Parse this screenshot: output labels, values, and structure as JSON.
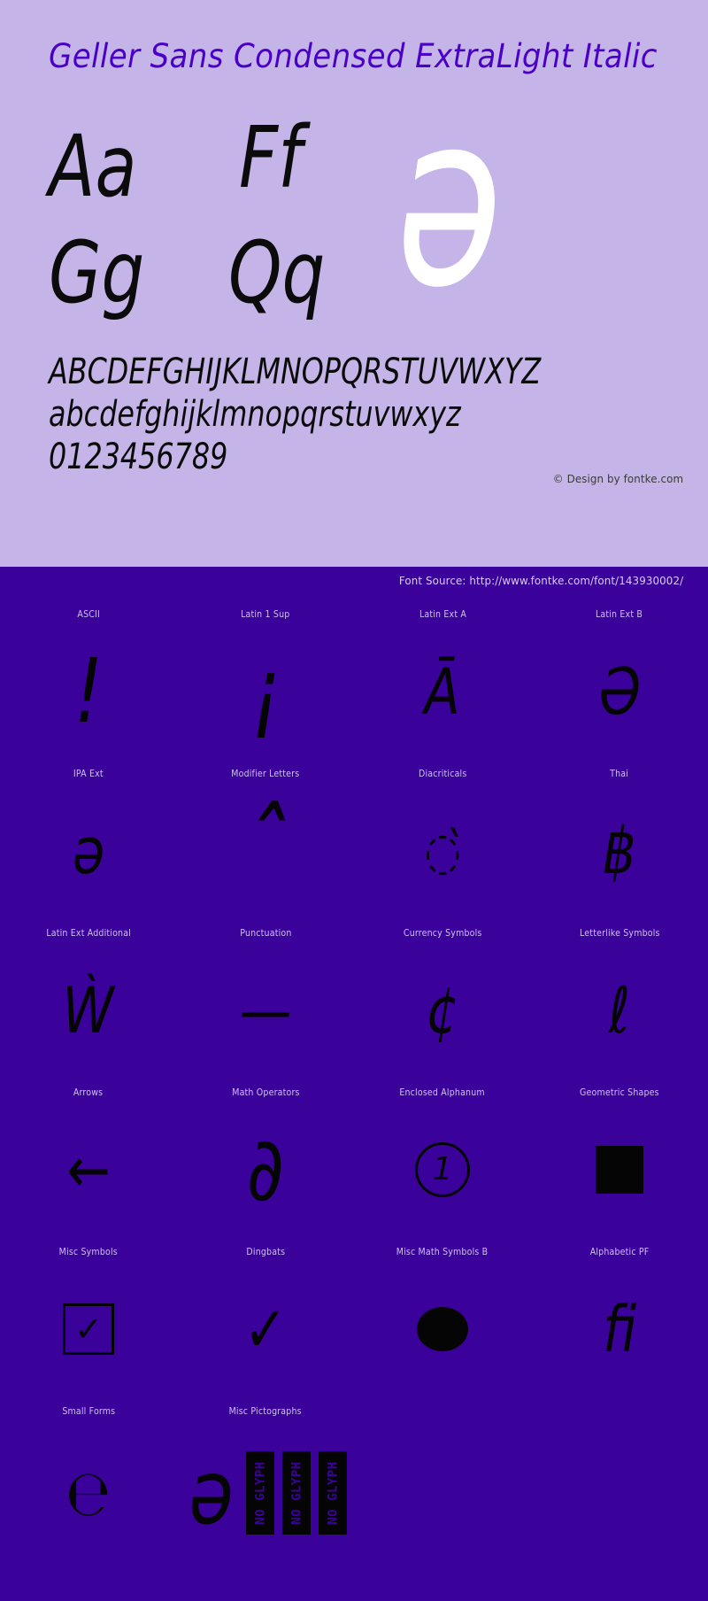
{
  "specimen": {
    "title": "Geller Sans Condensed ExtraLight Italic",
    "background_color": "#c5b4e8",
    "title_color": "#4b00c8",
    "sample_pairs": [
      "Aa",
      "Ff",
      "Gg",
      "Qq"
    ],
    "hero_glyph": "ə",
    "hero_color": "#ffffff",
    "alphabet_upper": "ABCDEFGHIJKLMNOPQRSTUVWXYZ",
    "alphabet_lower": "abcdefghijklmnopqrstuvwxyz",
    "digits": "0123456789",
    "credit": "© Design by fontke.com"
  },
  "source_bar": {
    "text": "Font Source: http://www.fontke.com/font/143930002/",
    "background_color": "#3a029b",
    "text_color": "#d7cdf0"
  },
  "glyph_section": {
    "background_color": "#3a029b",
    "label_color": "#cfc2ee",
    "glyph_color": "#050505",
    "rows": [
      {
        "cells": [
          {
            "label": "ASCII",
            "glyph": "!",
            "kind": "char",
            "size": "lg"
          },
          {
            "label": "Latin 1 Sup",
            "glyph": "¡",
            "kind": "char",
            "size": "lg"
          },
          {
            "label": "Latin Ext A",
            "glyph": "Ā",
            "kind": "char",
            "size": "md"
          },
          {
            "label": "Latin Ext B",
            "glyph": "Ə",
            "kind": "char",
            "size": "md"
          }
        ]
      },
      {
        "cells": [
          {
            "label": "IPA Ext",
            "glyph": "ə",
            "kind": "char",
            "size": "md"
          },
          {
            "label": "Modifier Letters",
            "glyph": "ˆ",
            "kind": "char",
            "size": "xl"
          },
          {
            "label": "Diacriticals",
            "glyph": "◌̀",
            "kind": "char",
            "size": "sm"
          },
          {
            "label": "Thai",
            "glyph": "฿",
            "kind": "char",
            "size": "md"
          }
        ]
      },
      {
        "cells": [
          {
            "label": "Latin Ext Additional",
            "glyph": "Ẁ",
            "kind": "char",
            "size": "md"
          },
          {
            "label": "Punctuation",
            "glyph": "—",
            "kind": "char",
            "size": "md"
          },
          {
            "label": "Currency Symbols",
            "glyph": "¢",
            "kind": "char",
            "size": "md"
          },
          {
            "label": "Letterlike Symbols",
            "glyph": "ℓ",
            "kind": "char",
            "size": "md"
          }
        ]
      },
      {
        "cells": [
          {
            "label": "Arrows",
            "glyph": "←",
            "kind": "char",
            "size": "md"
          },
          {
            "label": "Math Operators",
            "glyph": "∂",
            "kind": "char",
            "size": "lg"
          },
          {
            "label": "Enclosed Alphanum",
            "glyph": "1",
            "kind": "circled",
            "size": "md"
          },
          {
            "label": "Geometric Shapes",
            "glyph": "■",
            "kind": "square",
            "size": "md"
          }
        ]
      },
      {
        "cells": [
          {
            "label": "Misc Symbols",
            "glyph": "✓",
            "kind": "boxed",
            "size": "md"
          },
          {
            "label": "Dingbats",
            "glyph": "✓",
            "kind": "char",
            "size": "md"
          },
          {
            "label": "Misc Math Symbols B",
            "glyph": "●",
            "kind": "ellipse",
            "size": "md"
          },
          {
            "label": "Alphabetic PF",
            "glyph": "ﬁ",
            "kind": "char",
            "size": "md"
          }
        ]
      },
      {
        "cells": [
          {
            "label": "Small Forms",
            "glyph": "℮",
            "kind": "char",
            "size": "md"
          },
          {
            "label": "Misc Pictographs",
            "glyph": "ə",
            "kind": "noglyph",
            "size": "md",
            "noglyph_labels": [
              "NO GLYPH",
              "NO GLYPH",
              "NO GLYPH"
            ]
          },
          {
            "label": "",
            "glyph": "",
            "kind": "empty",
            "size": "md"
          },
          {
            "label": "",
            "glyph": "",
            "kind": "empty",
            "size": "md"
          }
        ]
      }
    ]
  }
}
